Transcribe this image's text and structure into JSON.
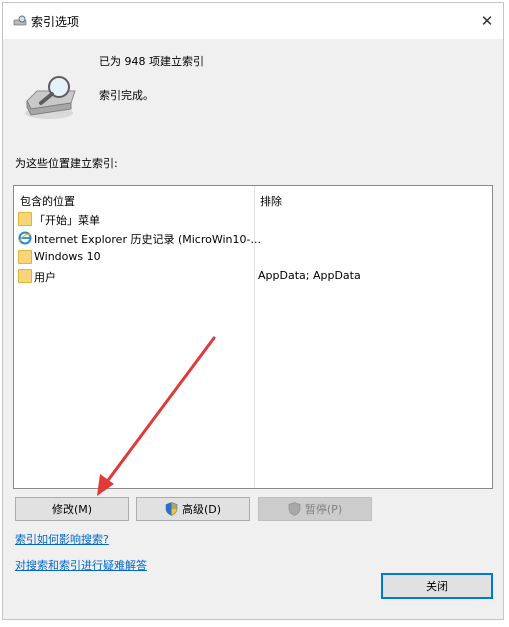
{
  "window": {
    "title": "索引选项",
    "close_glyph": "✕"
  },
  "status": {
    "indexed_count": "已为 948 项建立索引",
    "completion": "索引完成。"
  },
  "list": {
    "section_label": "为这些位置建立索引:",
    "columns": {
      "included": "包含的位置",
      "excluded": "排除"
    },
    "rows": [
      {
        "icon": "folder-icon",
        "location": "「开始」菜单",
        "exclude": ""
      },
      {
        "icon": "ie-icon",
        "location": "Internet Explorer 历史记录 (MicroWin10-...",
        "exclude": ""
      },
      {
        "icon": "folder-icon",
        "location": "Windows 10",
        "exclude": ""
      },
      {
        "icon": "folder-icon",
        "location": "用户",
        "exclude": "AppData; AppData"
      }
    ]
  },
  "buttons": {
    "modify": "修改(M)",
    "advanced": "高级(D)",
    "pause": "暂停(P)",
    "close": "关闭"
  },
  "links": {
    "how_affects_search": "索引如何影响搜索?",
    "troubleshoot": "对搜索和索引进行疑难解答"
  },
  "colors": {
    "link": "#0066cc",
    "focus_border": "#0078d7",
    "annotation_arrow": "#e03a3a"
  }
}
